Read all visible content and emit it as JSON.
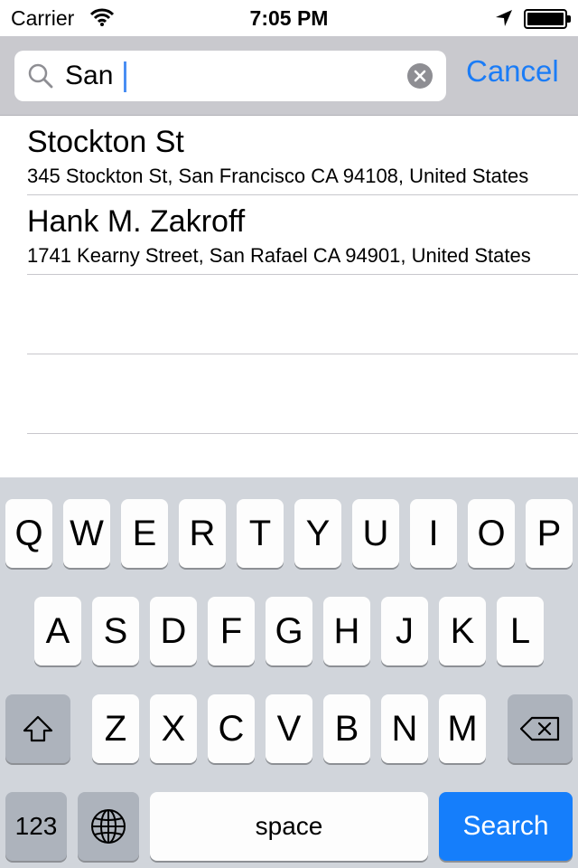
{
  "status_bar": {
    "carrier": "Carrier",
    "time": "7:05 PM"
  },
  "search": {
    "value": "San",
    "cancel_label": "Cancel"
  },
  "results": [
    {
      "title": "Stockton St",
      "subtitle": "345 Stockton St, San Francisco CA 94108, United States"
    },
    {
      "title": "Hank M. Zakroff",
      "subtitle": "1741 Kearny Street, San Rafael CA 94901, United States"
    }
  ],
  "keyboard": {
    "row1": [
      "Q",
      "W",
      "E",
      "R",
      "T",
      "Y",
      "U",
      "I",
      "O",
      "P"
    ],
    "row2": [
      "A",
      "S",
      "D",
      "F",
      "G",
      "H",
      "J",
      "K",
      "L"
    ],
    "row3": [
      "Z",
      "X",
      "C",
      "V",
      "B",
      "N",
      "M"
    ],
    "numbers_label": "123",
    "space_label": "space",
    "search_label": "Search"
  },
  "colors": {
    "accent": "#1a7cf7",
    "search_key": "#157efb",
    "keyboard_bg": "#d1d5db",
    "search_bar_bg": "#c9c9ce"
  }
}
